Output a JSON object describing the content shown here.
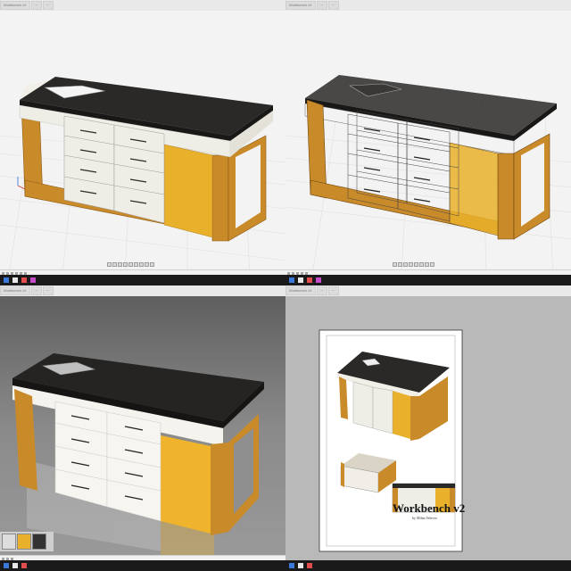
{
  "panels": [
    {
      "id": "modeling-viewport",
      "tabs": [
        "Workbench v2",
        "···",
        "···"
      ]
    },
    {
      "id": "wireframe-viewport",
      "tabs": [
        "Workbench v2",
        "···",
        "···"
      ]
    },
    {
      "id": "render-viewport",
      "tabs": [
        "Workbench v2",
        "···",
        "···"
      ]
    },
    {
      "id": "drawing-sheet",
      "tabs": [
        "Workbench v2",
        "···",
        "···"
      ]
    }
  ],
  "drawing": {
    "title": "Workbench v2",
    "author": "by Milan Šeleceo"
  },
  "colors": {
    "top": "#2b2927",
    "drawers": "#efeee6",
    "wood": "#c98a2a",
    "panel": "#e9b02c",
    "grid_bg": "#f2f2f2",
    "render_bg": "#7c7c7c",
    "sheet_bg": "#b9b9b9",
    "taskbar": "#1a1a1a"
  },
  "icons": [
    "orbit-icon",
    "pan-icon",
    "zoom-icon",
    "fit-icon",
    "display-icon",
    "grid-icon"
  ]
}
